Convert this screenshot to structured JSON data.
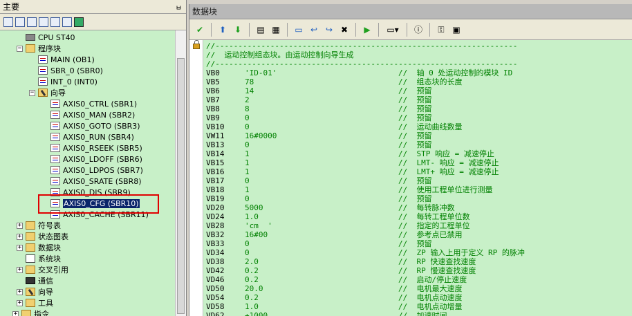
{
  "left_pane": {
    "title": "主要",
    "pin": "ㅂ",
    "tree": [
      {
        "label": "CPU ST40",
        "icon": "cpu-icon",
        "expander": ""
      },
      {
        "label": "程序块",
        "icon": "folder-icon",
        "expander": "−"
      },
      {
        "label": "MAIN (OB1)",
        "icon": "program-icon",
        "expander": ""
      },
      {
        "label": "SBR_0 (SBR0)",
        "icon": "program-icon",
        "expander": ""
      },
      {
        "label": "INT_0 (INT0)",
        "icon": "program-icon",
        "expander": ""
      },
      {
        "label": "向导",
        "icon": "wizard-icon",
        "expander": "−"
      },
      {
        "label": "AXIS0_CTRL (SBR1)",
        "icon": "program-icon",
        "expander": ""
      },
      {
        "label": "AXIS0_MAN (SBR2)",
        "icon": "program-icon",
        "expander": ""
      },
      {
        "label": "AXIS0_GOTO (SBR3)",
        "icon": "program-icon",
        "expander": ""
      },
      {
        "label": "AXIS0_RUN (SBR4)",
        "icon": "program-icon",
        "expander": ""
      },
      {
        "label": "AXIS0_RSEEK (SBR5)",
        "icon": "program-icon",
        "expander": ""
      },
      {
        "label": "AXIS0_LDOFF (SBR6)",
        "icon": "program-icon",
        "expander": ""
      },
      {
        "label": "AXIS0_LDPOS (SBR7)",
        "icon": "program-icon",
        "expander": ""
      },
      {
        "label": "AXIS0_SRATE (SBR8)",
        "icon": "program-icon",
        "expander": ""
      },
      {
        "label": "AXIS0_DIS (SBR9)",
        "icon": "program-icon",
        "expander": ""
      },
      {
        "label": "AXIS0_CFG (SBR10)",
        "icon": "program-icon",
        "expander": "",
        "selected": true
      },
      {
        "label": "AXIS0_CACHE (SBR11)",
        "icon": "program-icon",
        "expander": ""
      },
      {
        "label": "符号表",
        "icon": "folder-icon",
        "expander": "+"
      },
      {
        "label": "状态图表",
        "icon": "folder-icon",
        "expander": "+"
      },
      {
        "label": "数据块",
        "icon": "folder-icon",
        "expander": "+"
      },
      {
        "label": "系统块",
        "icon": "system-block-icon",
        "expander": ""
      },
      {
        "label": "交叉引用",
        "icon": "folder-icon",
        "expander": "+"
      },
      {
        "label": "通信",
        "icon": "communication-icon",
        "expander": ""
      },
      {
        "label": "向导",
        "icon": "wizard-icon",
        "expander": "+"
      },
      {
        "label": "工具",
        "icon": "folder-icon",
        "expander": "+"
      },
      {
        "label": "指令",
        "icon": "folder-icon",
        "expander": "+"
      }
    ]
  },
  "right_pane": {
    "title": "数据块",
    "lines": [
      {
        "type": "comment",
        "text": "//------------------------------------------------------------------"
      },
      {
        "type": "comment",
        "text": "//  运动控制组态块。由运动控制向导生成"
      },
      {
        "type": "comment",
        "text": "//------------------------------------------------------------------"
      },
      {
        "type": "data",
        "addr": "VB0",
        "val": "'ID-01'",
        "cmt": "//  轴 0 处运动控制的模块 ID"
      },
      {
        "type": "data",
        "addr": "VB5",
        "val": "78",
        "cmt": "//  组态块的长度"
      },
      {
        "type": "data",
        "addr": "VB6",
        "val": "14",
        "cmt": "//  预留"
      },
      {
        "type": "data",
        "addr": "VB7",
        "val": "2",
        "cmt": "//  预留"
      },
      {
        "type": "data",
        "addr": "VB8",
        "val": "8",
        "cmt": "//  预留"
      },
      {
        "type": "data",
        "addr": "VB9",
        "val": "0",
        "cmt": "//  预留"
      },
      {
        "type": "data",
        "addr": "VB10",
        "val": "0",
        "cmt": "//  运动曲线数量"
      },
      {
        "type": "data",
        "addr": "VW11",
        "val": "16#0000",
        "cmt": "//  预留"
      },
      {
        "type": "data",
        "addr": "VB13",
        "val": "0",
        "cmt": "//  预留"
      },
      {
        "type": "data",
        "addr": "VB14",
        "val": "1",
        "cmt": "//  STP 响应 = 减速停止"
      },
      {
        "type": "data",
        "addr": "VB15",
        "val": "1",
        "cmt": "//  LMT- 响应 = 减速停止"
      },
      {
        "type": "data",
        "addr": "VB16",
        "val": "1",
        "cmt": "//  LMT+ 响应 = 减速停止"
      },
      {
        "type": "data",
        "addr": "VB17",
        "val": "0",
        "cmt": "//  预留"
      },
      {
        "type": "data",
        "addr": "VB18",
        "val": "1",
        "cmt": "//  使用工程单位进行测量"
      },
      {
        "type": "data",
        "addr": "VB19",
        "val": "0",
        "cmt": "//  预留"
      },
      {
        "type": "data",
        "addr": "VD20",
        "val": "5000",
        "cmt": "//  每转脉冲数"
      },
      {
        "type": "data",
        "addr": "VD24",
        "val": "1.0",
        "cmt": "//  每转工程单位数"
      },
      {
        "type": "data",
        "addr": "VB28",
        "val": "'cm  '",
        "cmt": "//  指定的工程单位"
      },
      {
        "type": "data",
        "addr": "VB32",
        "val": "16#00",
        "cmt": "//  参考点已禁用"
      },
      {
        "type": "data",
        "addr": "VB33",
        "val": "0",
        "cmt": "//  预留"
      },
      {
        "type": "data",
        "addr": "VD34",
        "val": "0",
        "cmt": "//  ZP 输入上用于定义 RP 的脉冲"
      },
      {
        "type": "data",
        "addr": "VD38",
        "val": "2.0",
        "cmt": "//  RP 快速查找速度"
      },
      {
        "type": "data",
        "addr": "VD42",
        "val": "0.2",
        "cmt": "//  RP 慢速查找速度"
      },
      {
        "type": "data",
        "addr": "VD46",
        "val": "0.2",
        "cmt": "//  启动/停止速度"
      },
      {
        "type": "data",
        "addr": "VD50",
        "val": "20.0",
        "cmt": "//  电机最大速度"
      },
      {
        "type": "data",
        "addr": "VD54",
        "val": "0.2",
        "cmt": "//  电机点动速度"
      },
      {
        "type": "data",
        "addr": "VD58",
        "val": "1.0",
        "cmt": "//  电机点动增量"
      },
      {
        "type": "data",
        "addr": "VD62",
        "val": "+1000",
        "cmt": "//  加速时间"
      }
    ]
  },
  "colors": {
    "tree_background": "#c8f0c8",
    "editor_background": "#c8f0c8",
    "comment_green": "#008000",
    "highlight_red": "#e00000",
    "selection_blue": "#0a246a"
  }
}
